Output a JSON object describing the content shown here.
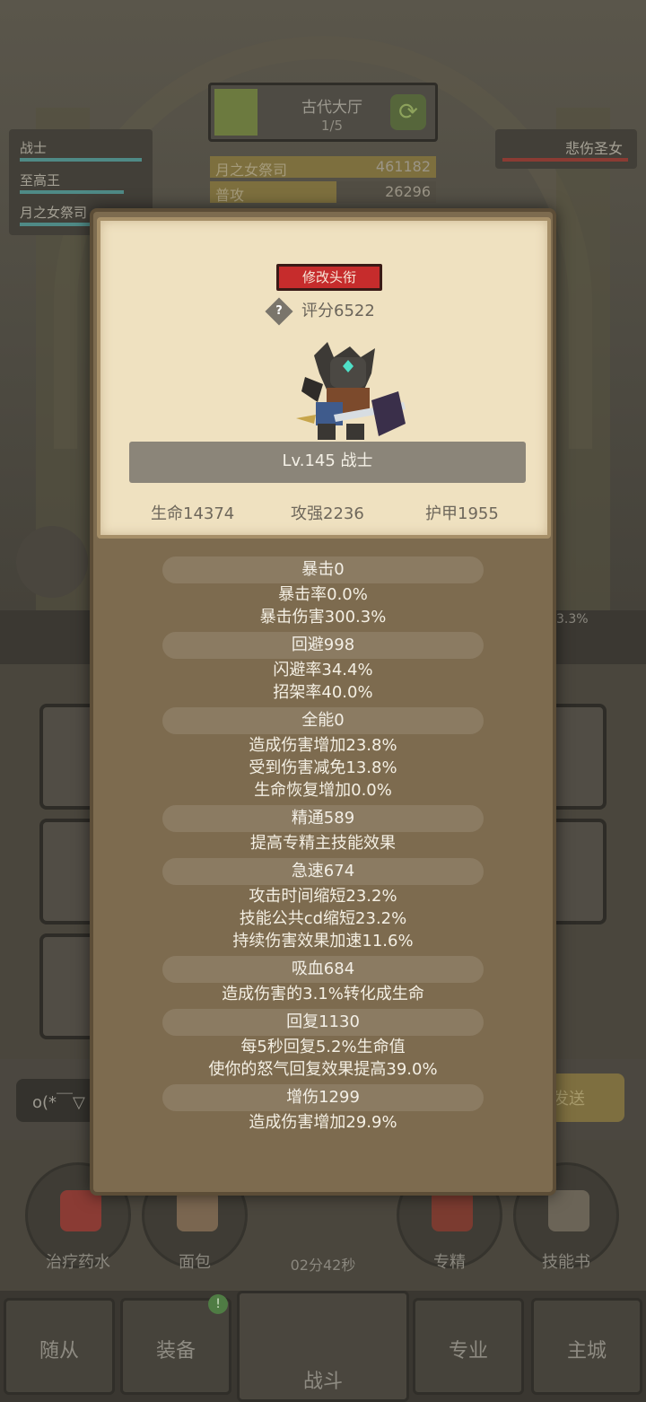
{
  "background": {
    "stage": {
      "title": "古代大厅",
      "progress": "1/5"
    },
    "damage_rows": [
      {
        "name": "月之女祭司",
        "value": "461182",
        "fill": 1.0
      },
      {
        "name": "普攻",
        "value": "26296",
        "fill": 0.56
      }
    ],
    "party": [
      "战士",
      "至高王",
      "月之女祭司"
    ],
    "enemy": {
      "name": "悲伤圣女"
    },
    "pct_text": "3.3%",
    "chat": {
      "input_text": "o(*￣▽",
      "send_label": "发送"
    },
    "actions": [
      {
        "label": "治疗药水",
        "color": "#8a3b34"
      },
      {
        "label": "面包",
        "color": "#7a6650"
      },
      {
        "label": "专精",
        "color": "#7b3b30"
      },
      {
        "label": "技能书",
        "color": "#6b6457"
      }
    ],
    "timer": "02分42秒",
    "tabs": [
      "随从",
      "装备",
      "战斗",
      "专业",
      "主城"
    ],
    "badge": "!"
  },
  "character": {
    "title_button": "修改头衔",
    "score": "评分6522",
    "level_name": "Lv.145 战士",
    "base_stats": {
      "hp": "生命14374",
      "atk": "攻强2236",
      "armor": "护甲1955"
    }
  },
  "stats": [
    {
      "head": "暴击0",
      "lines": [
        "暴击率0.0%",
        "暴击伤害300.3%"
      ]
    },
    {
      "head": "回避998",
      "lines": [
        "闪避率34.4%",
        "招架率40.0%"
      ]
    },
    {
      "head": "全能0",
      "lines": [
        "造成伤害增加23.8%",
        "受到伤害减免13.8%",
        "生命恢复增加0.0%"
      ]
    },
    {
      "head": "精通589",
      "lines": [
        "提高专精主技能效果"
      ]
    },
    {
      "head": "急速674",
      "lines": [
        "攻击时间缩短23.2%",
        "技能公共cd缩短23.2%",
        "持续伤害效果加速11.6%"
      ]
    },
    {
      "head": "吸血684",
      "lines": [
        "造成伤害的3.1%转化成生命"
      ]
    },
    {
      "head": "回复1130",
      "lines": [
        "每5秒回复5.2%生命值",
        "使你的怒气回复效果提高39.0%"
      ]
    },
    {
      "head": "增伤1299",
      "lines": [
        "造成伤害增加29.9%"
      ]
    }
  ]
}
